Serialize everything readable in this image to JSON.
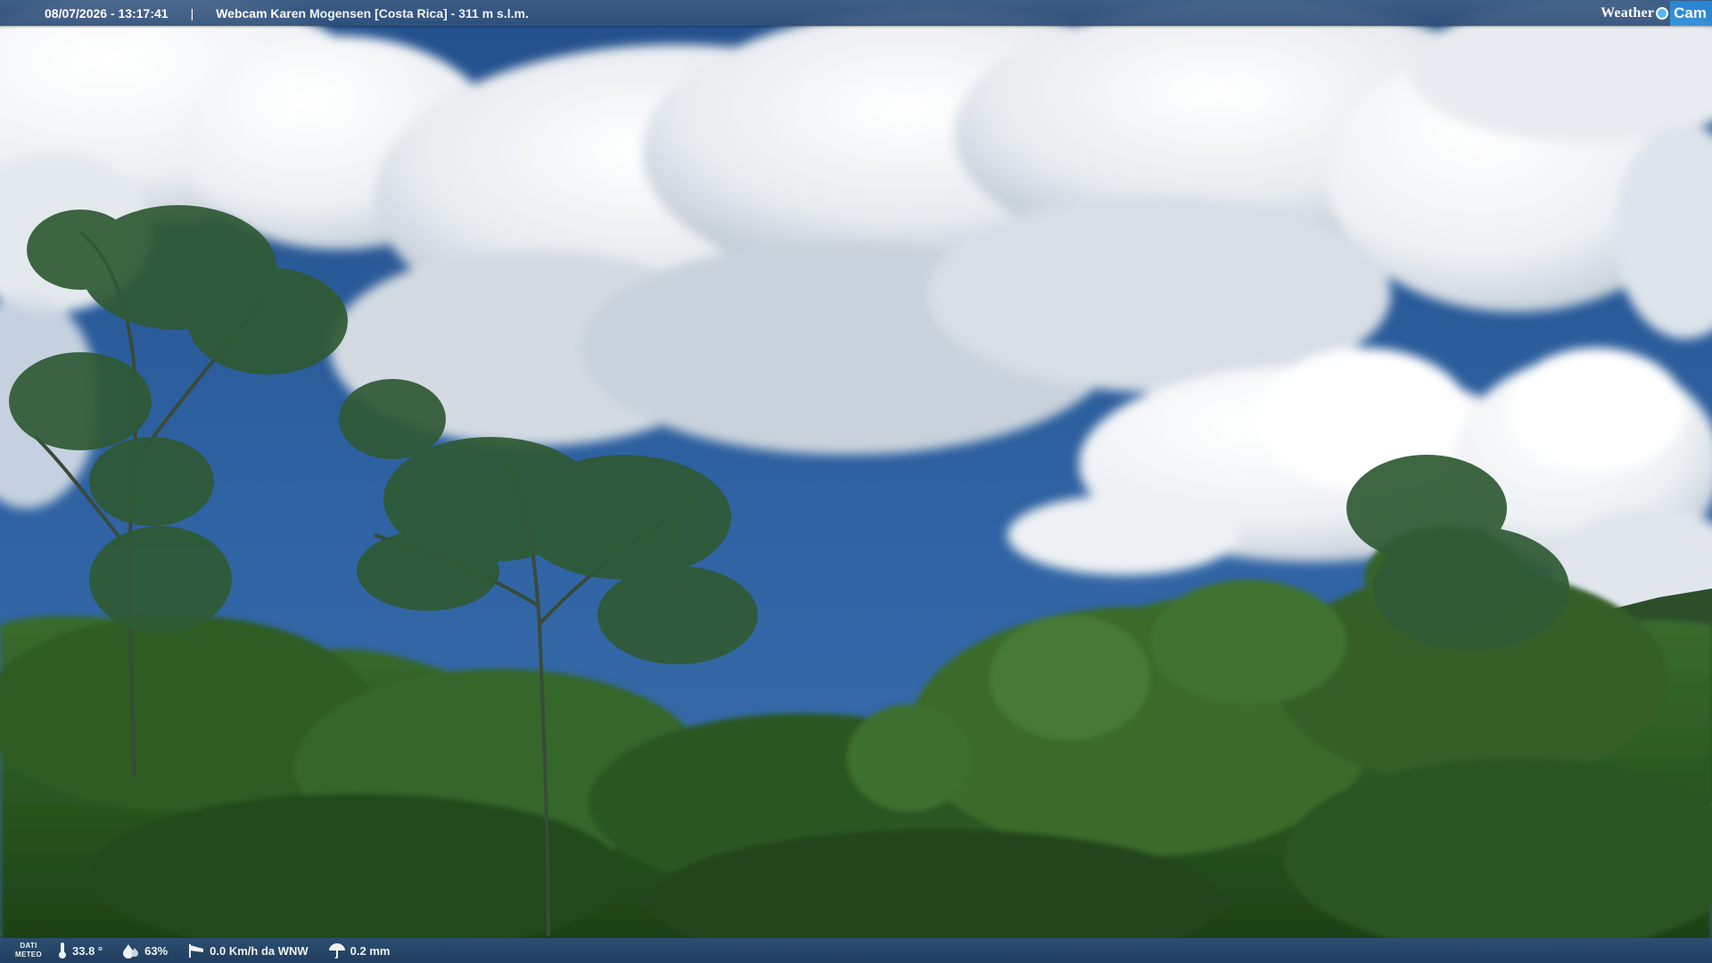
{
  "overlay": {
    "timestamp": "08/07/2026 - 13:17:41",
    "separator": "|",
    "camera_title": "Webcam Karen Mogensen [Costa Rica] - 311 m s.l.m."
  },
  "brand": {
    "weather_text": "Weather",
    "cam_text": "Cam",
    "colors": {
      "accent": "#2a8ad6"
    }
  },
  "weather": {
    "label_line1": "DATI",
    "label_line2": "METEO",
    "temperature": "33.8 °",
    "humidity": "63%",
    "wind": "0.0 Km/h da WNW",
    "rain": "0.2 mm",
    "icons": [
      "thermometer-icon",
      "humidity-drop-icon",
      "wind-sock-icon",
      "rain-umbrella-icon"
    ]
  },
  "scene": {
    "description_colors": {
      "sky": "#2f5f9e",
      "cloud": "#e8ebee",
      "forest": "#2e5a22"
    }
  }
}
